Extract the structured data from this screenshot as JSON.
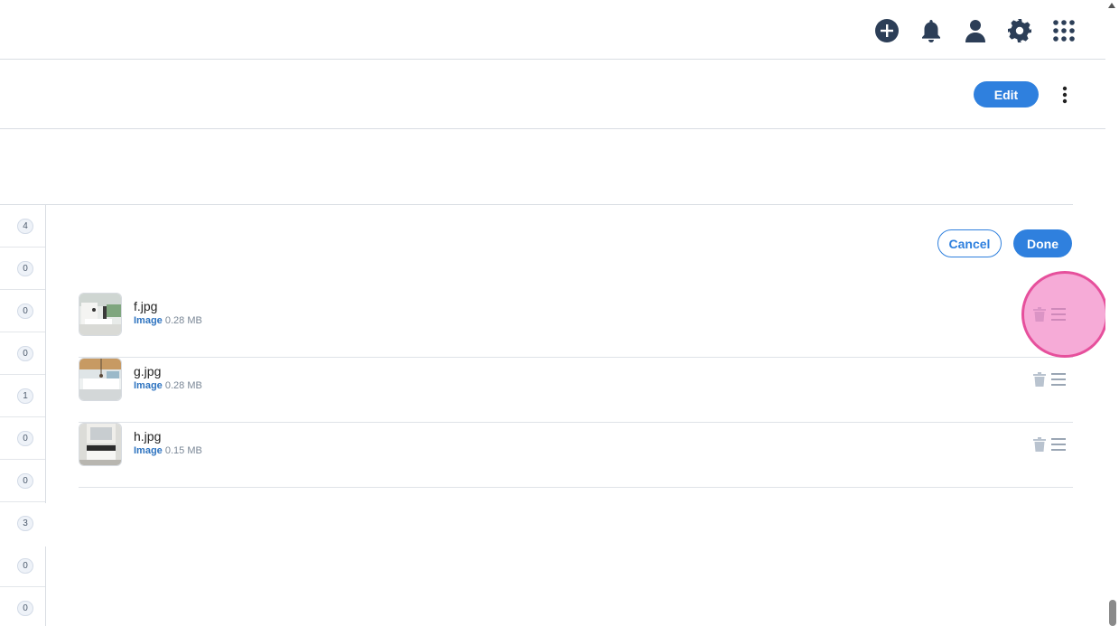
{
  "header": {
    "icons": [
      "add-circle-icon",
      "bell-icon",
      "user-icon",
      "gear-icon",
      "apps-grid-icon"
    ]
  },
  "subheader": {
    "edit_label": "Edit"
  },
  "actions": {
    "cancel_label": "Cancel",
    "done_label": "Done"
  },
  "left_counts": [
    "4",
    "0",
    "0",
    "0",
    "1",
    "0",
    "0",
    "3",
    "0",
    "0"
  ],
  "files": [
    {
      "name": "f.jpg",
      "type": "Image",
      "size": "0.28 MB"
    },
    {
      "name": "g.jpg",
      "type": "Image",
      "size": "0.28 MB"
    },
    {
      "name": "h.jpg",
      "type": "Image",
      "size": "0.15 MB"
    }
  ],
  "colors": {
    "accent": "#2f80de",
    "icon_dark": "#2c3e57",
    "highlight": "#e6509c"
  }
}
